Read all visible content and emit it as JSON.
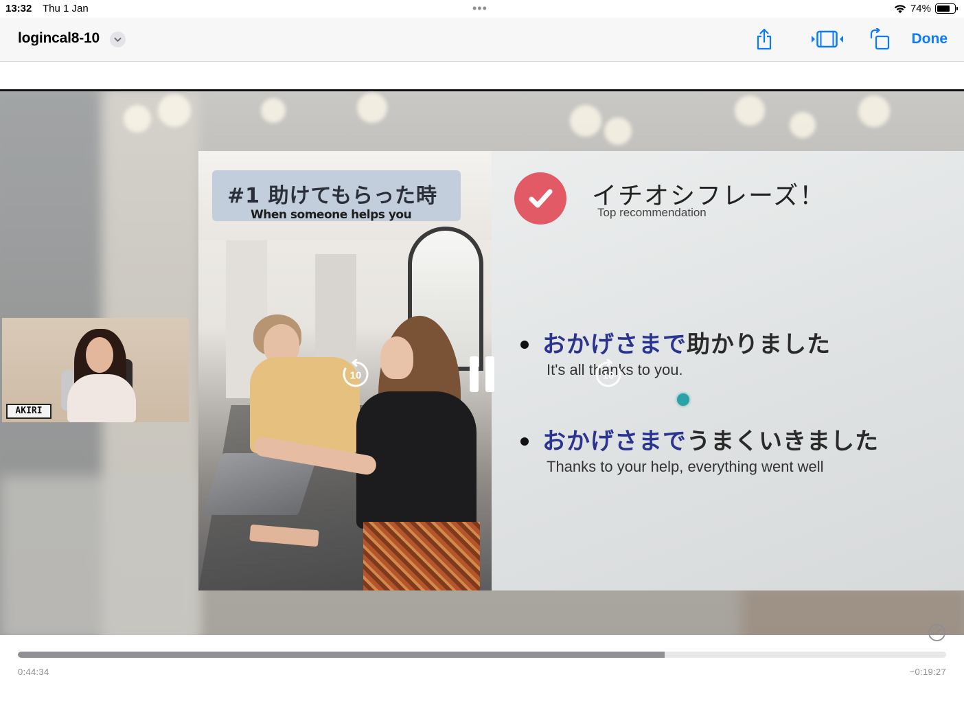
{
  "status_bar": {
    "time": "13:32",
    "date": "Thu 1 Jan",
    "battery_percent": "74%",
    "battery_level": 0.74
  },
  "nav": {
    "title": "logincal8-10",
    "done_label": "Done",
    "icons": [
      "chevron-down-icon",
      "share-icon",
      "trim-video-icon",
      "rotate-icon"
    ]
  },
  "slide": {
    "photo_title": "#1 助けてもらった時",
    "photo_subtitle": "When someone helps you",
    "rec_title": "イチオシフレーズ！",
    "rec_subtitle": "Top recommendation",
    "phrases": [
      {
        "highlight": "おかげさまで",
        "rest": "助かりました",
        "english": "It's all thanks to you."
      },
      {
        "highlight": "おかげさまで",
        "rest": "うまくいきました",
        "english": "Thanks to your help, everything went well"
      }
    ]
  },
  "webcam": {
    "name_tag": "AKIRI"
  },
  "controls": {
    "skip_back_seconds": "10",
    "skip_forward_seconds": "10",
    "state": "playing",
    "icons": [
      "skip-back-10-icon",
      "pause-icon",
      "skip-forward-10-icon",
      "playback-speed-icon"
    ]
  },
  "playback": {
    "elapsed": "0:44:34",
    "remaining": "−0:19:27",
    "progress": 0.697
  },
  "colors": {
    "accent": "#0a7aff",
    "check_badge": "#e25a66",
    "phrase_highlight": "#2b3590"
  }
}
